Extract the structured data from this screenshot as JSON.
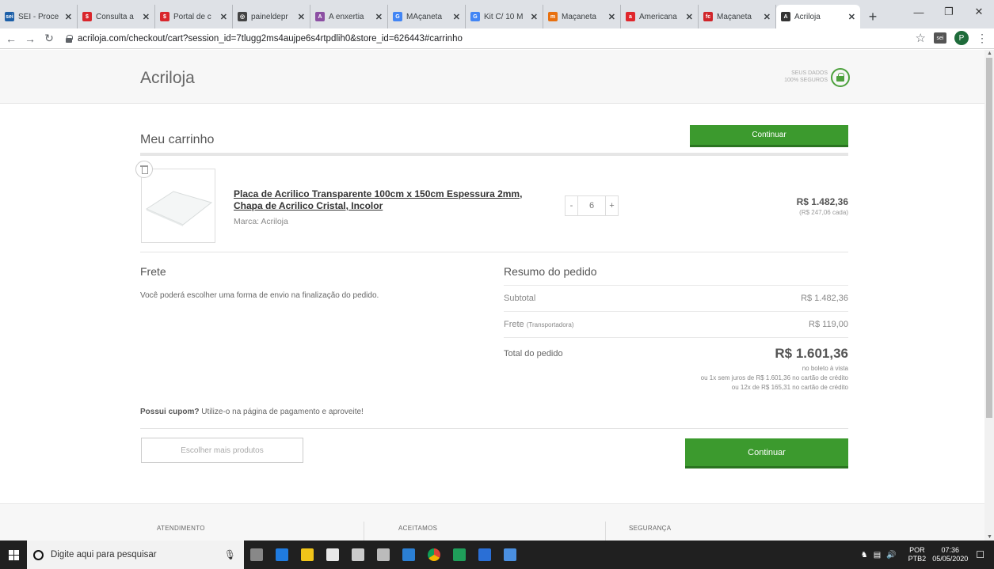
{
  "browser": {
    "tabs": [
      {
        "label": "SEI - Proce",
        "color": "#1c5fa8",
        "glyph": "sei"
      },
      {
        "label": "Consulta a",
        "color": "#d9262c",
        "glyph": "$"
      },
      {
        "label": "Portal de c",
        "color": "#d9262c",
        "glyph": "$"
      },
      {
        "label": "paineldepr",
        "color": "#444444",
        "glyph": "◎"
      },
      {
        "label": "A enxertia",
        "color": "#8c4fa3",
        "glyph": "A"
      },
      {
        "label": "MAçaneta",
        "color": "#4285f4",
        "glyph": "G"
      },
      {
        "label": "Kit C/ 10 M",
        "color": "#4285f4",
        "glyph": "G"
      },
      {
        "label": "Maçaneta",
        "color": "#e8700f",
        "glyph": "m"
      },
      {
        "label": "Americana",
        "color": "#e0262c",
        "glyph": "a"
      },
      {
        "label": "Maçaneta",
        "color": "#d0252a",
        "glyph": "fc"
      },
      {
        "label": "Acriloja",
        "color": "#333333",
        "glyph": "A"
      }
    ],
    "url": "acriloja.com/checkout/cart?session_id=7tlugg2ms4aujpe6s4rtpdlih0&store_id=626443#carrinho",
    "profile_initial": "P",
    "ext_label": "sei"
  },
  "header": {
    "logo": "Acriloja",
    "safe_line1": "SEUS DADOS",
    "safe_line2": "100% SEGUROS"
  },
  "cart": {
    "title": "Meu carrinho",
    "continue_top": "Continuar",
    "item": {
      "name": "Placa de Acrilico Transparente 100cm x 150cm Espessura 2mm, Chapa de Acrilico Cristal, Incolor",
      "brand": "Marca: Acriloja",
      "qty_minus": "-",
      "qty": "6",
      "qty_plus": "+",
      "price": "R$ 1.482,36",
      "price_each": "(R$ 247,06 cada)"
    }
  },
  "frete": {
    "title": "Frete",
    "text": "Você poderá escolher uma forma de envio na finalização do pedido."
  },
  "resumo": {
    "title": "Resumo do pedido",
    "subtotal_label": "Subtotal",
    "subtotal_value": "R$ 1.482,36",
    "frete_label": "Frete",
    "frete_sub": "(Transportadora)",
    "frete_value": "R$ 119,00",
    "total_label": "Total do pedido",
    "total_value": "R$ 1.601,36",
    "note1": "no boleto à vista",
    "note2": "ou 1x sem juros de R$ 1.601,36 no cartão de crédito",
    "note3": "ou 12x de R$ 165,31 no cartão de crédito"
  },
  "cupom": {
    "bold": "Possui cupom?",
    "text": " Utilize-o na página de pagamento e aproveite!"
  },
  "actions": {
    "more_products": "Escolher mais produtos",
    "continue_bottom": "Continuar"
  },
  "footer": {
    "col1": "ATENDIMENTO",
    "col2": "ACEITAMOS",
    "col3": "SEGURANÇA"
  },
  "taskbar": {
    "search_placeholder": "Digite aqui para pesquisar",
    "lang1": "POR",
    "lang2": "PTB2",
    "time": "07:36",
    "date": "05/05/2020",
    "apps": [
      "#888",
      "#1f7be0",
      "#f0c419",
      "#e8e8e8",
      "#cccccc",
      "#bbbbbb",
      "#2b7fd3",
      "#e34a2f",
      "#1f9e5a",
      "#2a6fd6",
      "#4a8fe0"
    ]
  }
}
